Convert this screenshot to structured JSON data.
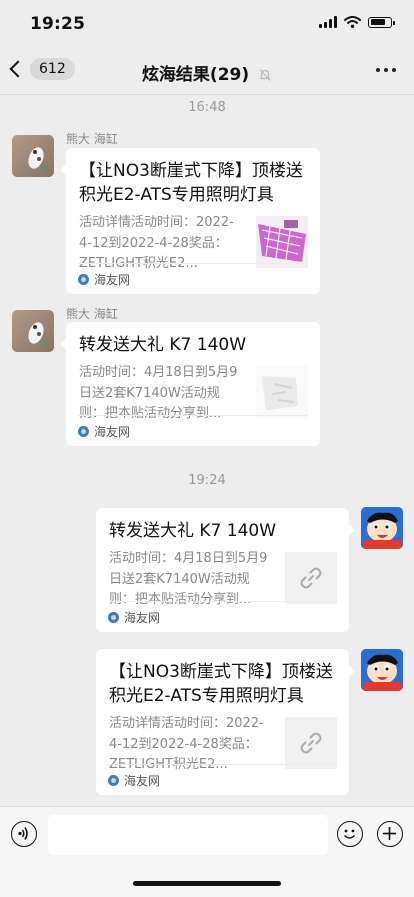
{
  "status": {
    "time": "19:25",
    "battery_level": 0.75
  },
  "nav": {
    "back_count": "612",
    "title": "炫海结果(29)"
  },
  "messages": {
    "ts1": "16:48",
    "ts2": "19:24",
    "m1": {
      "sender": "熊大 海缸",
      "title": "【让NO3断崖式下降】顶楼送积光E2-ATS专用照明灯具",
      "desc": "活动详情活动时间：2022-4-12到2022-4-28奖品：ZETLIGHT积光E2...",
      "source": "海友网"
    },
    "m2": {
      "sender": "熊大 海缸",
      "title": "转发送大礼 K7 140W",
      "desc": "活动时间：4月18日到5月9日送2套K7140W活动规则：把本贴活动分享到...",
      "source": "海友网"
    },
    "m3": {
      "title": "转发送大礼 K7 140W",
      "desc": "活动时间：4月18日到5月9日送2套K7140W活动规则：把本贴活动分享到...",
      "source": "海友网"
    },
    "m4": {
      "title": "【让NO3断崖式下降】顶楼送积光E2-ATS专用照明灯具",
      "desc": "活动详情活动时间：2022-4-12到2022-4-28奖品：ZETLIGHT积光E2...",
      "source": "海友网"
    }
  },
  "colors": {
    "background": "#ededed",
    "card": "#ffffff",
    "secondary_text": "#888888"
  },
  "icons": [
    "signal-icon",
    "wifi-icon",
    "battery-icon",
    "back-chevron-icon",
    "mute-icon",
    "more-icon",
    "link-icon",
    "voice-icon",
    "emoji-icon",
    "plus-icon"
  ]
}
